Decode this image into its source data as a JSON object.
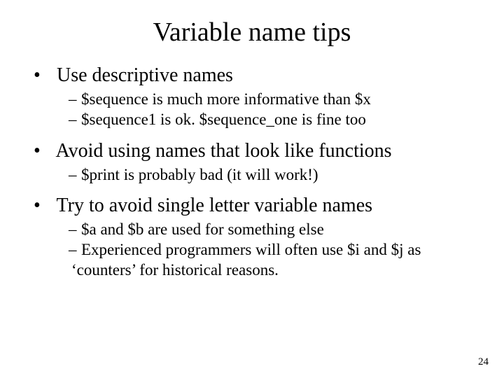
{
  "title": "Variable name tips",
  "bullets": {
    "b1": {
      "text": "Use descriptive names",
      "sub": [
        "$sequence is much more informative than $x",
        "$sequence1 is ok.  $sequence_one is fine too"
      ]
    },
    "b2": {
      "text": "Avoid using names that look like functions",
      "sub": [
        "$print is probably bad (it will work!)"
      ]
    },
    "b3": {
      "text": "Try to avoid single letter variable names",
      "sub": [
        "$a and $b are used for something else",
        "Experienced programmers will often use $i and $j as ‘counters’ for historical reasons."
      ]
    }
  },
  "page_number": "24"
}
